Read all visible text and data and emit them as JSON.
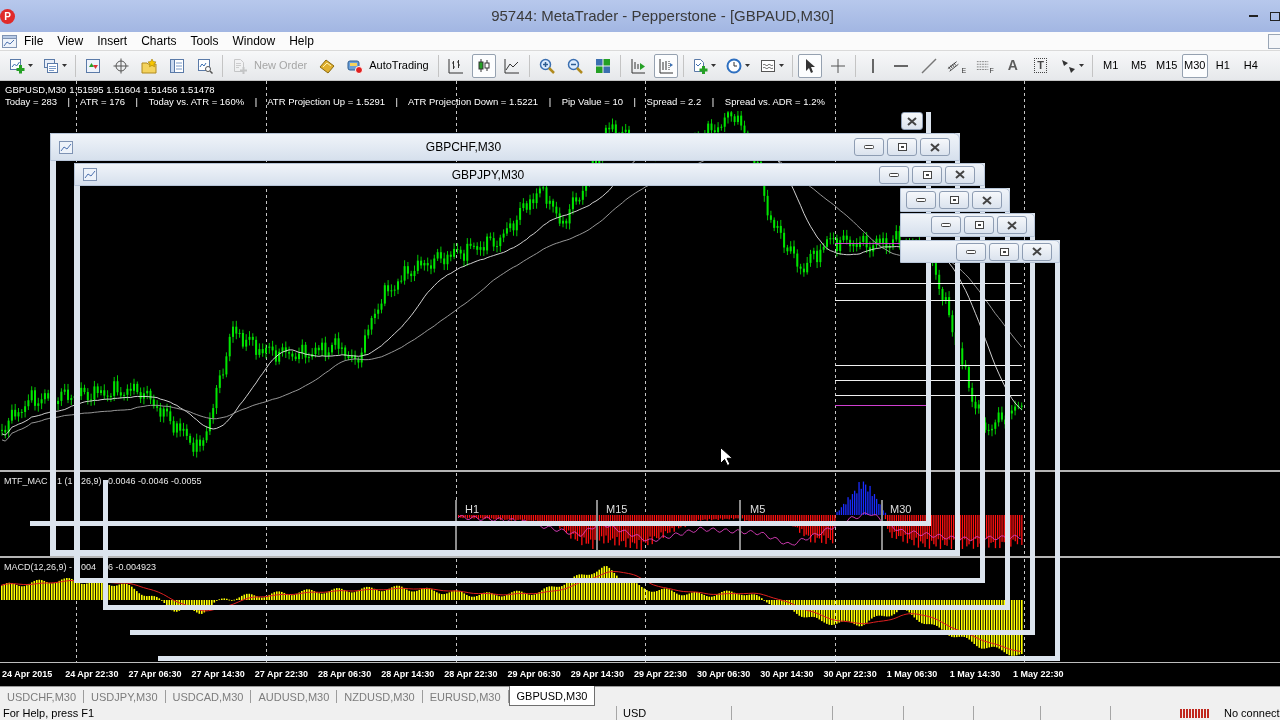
{
  "title_bar": {
    "logo": "P",
    "title": "95744: MetaTrader - Pepperstone - [GBPAUD,M30]"
  },
  "menu": [
    "File",
    "View",
    "Insert",
    "Charts",
    "Tools",
    "Window",
    "Help"
  ],
  "toolbar": [
    [
      {
        "kind": "new-chart",
        "dropdown": true
      },
      {
        "kind": "profiles",
        "dropdown": true
      }
    ],
    [
      {
        "kind": "market-watch"
      },
      {
        "kind": "data-window"
      },
      {
        "kind": "navigator"
      },
      {
        "kind": "terminal"
      },
      {
        "kind": "tester"
      }
    ],
    [
      {
        "kind": "new-order",
        "label": "New Order",
        "disabled": true
      },
      {
        "kind": "editor",
        "disabled": false
      },
      {
        "kind": "autotrading",
        "label": "AutoTrading",
        "disabled": false
      }
    ],
    [
      {
        "kind": "bar-chart",
        "selected": false
      },
      {
        "kind": "candle-chart",
        "selected": true
      },
      {
        "kind": "line-chart",
        "selected": false
      }
    ],
    [
      {
        "kind": "zoom-in"
      },
      {
        "kind": "zoom-out"
      },
      {
        "kind": "tile"
      }
    ],
    [
      {
        "kind": "auto-scroll",
        "on": false
      },
      {
        "kind": "chart-shift",
        "on": true
      }
    ],
    [
      {
        "kind": "indicators",
        "dropdown": true
      },
      {
        "kind": "periods",
        "dropdown": true
      },
      {
        "kind": "templates",
        "dropdown": true
      }
    ],
    [
      {
        "kind": "cursor",
        "selected": true
      },
      {
        "kind": "crosshair",
        "selected": false
      }
    ],
    [
      {
        "kind": "vertical-line"
      },
      {
        "kind": "horizontal-line"
      },
      {
        "kind": "trend-line"
      },
      {
        "kind": "channel",
        "label": "E"
      },
      {
        "kind": "fibonacci",
        "label": "F"
      },
      {
        "kind": "text",
        "label": "A"
      },
      {
        "kind": "text-label",
        "label": "T"
      },
      {
        "kind": "arrows",
        "dropdown": true
      }
    ],
    [
      {
        "kind": "timeframe",
        "label": "M1",
        "selected": false
      },
      {
        "kind": "timeframe",
        "label": "M5",
        "selected": false
      },
      {
        "kind": "timeframe",
        "label": "M15",
        "selected": false
      },
      {
        "kind": "timeframe",
        "label": "M30",
        "selected": true
      },
      {
        "kind": "timeframe",
        "label": "H1",
        "selected": false
      },
      {
        "kind": "timeframe",
        "label": "H4",
        "selected": false
      }
    ]
  ],
  "chart": {
    "symbol": "GBPUSD,M30",
    "quote": "1.51595 1.51604 1.51456 1.51478",
    "stats": "Today = 283    |    ATR = 176    |    Today vs. ATR = 160%    |    ATR Projection Up = 1.5291    |    ATR Projection Down = 1.5221    |    Pip Value = 10    |    Spread = 2.2    |    Spread vs. ADR = 1.2%"
  },
  "mtf_macd": {
    "label_parts": [
      "MTF_MAC",
      "1 (1",
      "26,9)",
      "0.0046 -0.0046 -0.0055"
    ],
    "timeframes": [
      "H1",
      "M15",
      "M5",
      "M30"
    ]
  },
  "macd": {
    "label_parts": [
      "MACD(12,26,9) -",
      "004",
      "6 -0.004923"
    ]
  },
  "time_axis": [
    "24 Apr 2015",
    "24 Apr 22:30",
    "27 Apr 06:30",
    "27 Apr 14:30",
    "27 Apr 22:30",
    "28 Apr 06:30",
    "28 Apr 14:30",
    "28 Apr 22:30",
    "29 Apr 06:30",
    "29 Apr 14:30",
    "29 Apr 22:30",
    "30 Apr 06:30",
    "30 Apr 14:30",
    "30 Apr 22:30",
    "1 May 06:30",
    "1 May 14:30",
    "1 May 22:30"
  ],
  "windows": [
    {
      "title": "GBPCHF,M30"
    },
    {
      "title": "GBPJPY,M30"
    }
  ],
  "tabs": [
    {
      "label": "USDCHF,M30",
      "selected": false
    },
    {
      "label": "USDJPY,M30",
      "selected": false
    },
    {
      "label": "USDCAD,M30",
      "selected": false
    },
    {
      "label": "AUDUSD,M30",
      "selected": false
    },
    {
      "label": "NZDUSD,M30",
      "selected": false
    },
    {
      "label": "EURUSD,M30",
      "selected": false
    },
    {
      "label": "GBPUSD,M30",
      "selected": true
    }
  ],
  "status_bar": {
    "help": "For Help, press F1",
    "currency": "USD",
    "connection": "No connect"
  }
}
